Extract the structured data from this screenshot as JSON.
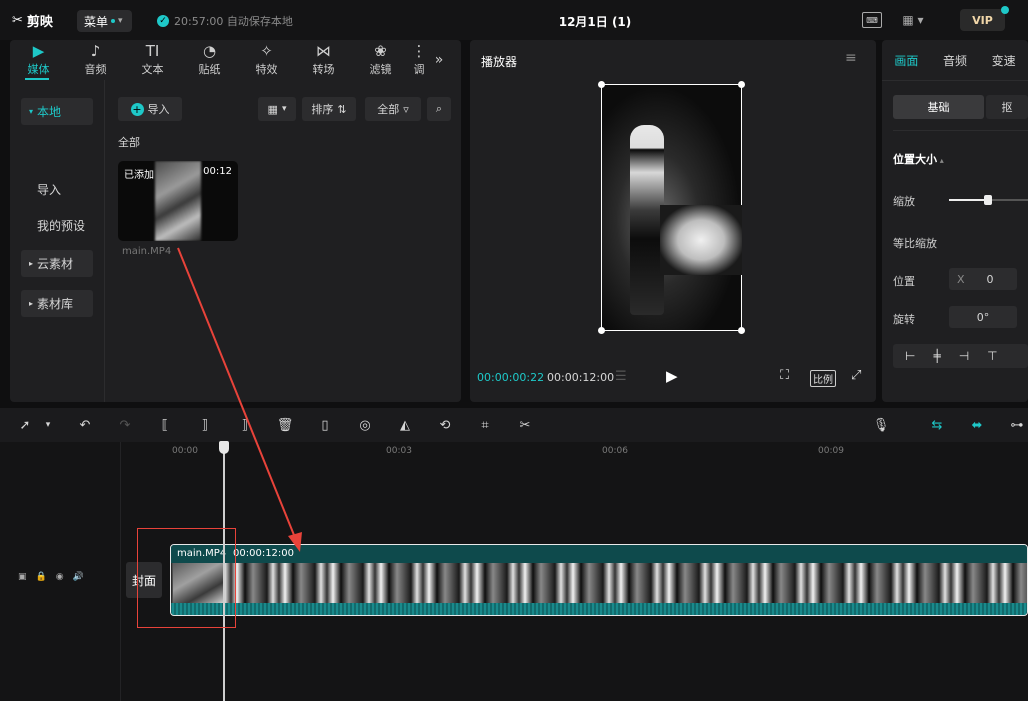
{
  "app": {
    "logo": "剪映",
    "menu_label": "菜单",
    "save_status": "20:57:00 自动保存本地",
    "project_title": "12月1日 (1)",
    "vip_label": "VIP"
  },
  "media_tabs": [
    {
      "label": "媒体",
      "icon": "media-icon",
      "active": true
    },
    {
      "label": "音频",
      "icon": "audio-icon"
    },
    {
      "label": "文本",
      "icon": "text-icon"
    },
    {
      "label": "贴纸",
      "icon": "sticker-icon"
    },
    {
      "label": "特效",
      "icon": "effects-icon"
    },
    {
      "label": "转场",
      "icon": "transition-icon"
    },
    {
      "label": "滤镜",
      "icon": "filter-icon"
    },
    {
      "label": "调",
      "icon": "adjust-icon"
    }
  ],
  "sidebar": {
    "items": [
      "本地",
      "导入",
      "我的预设",
      "云素材",
      "素材库"
    ]
  },
  "media": {
    "import_label": "导入",
    "sort_label": "排序",
    "all_filter_label": "全部",
    "section_label": "全部",
    "clip": {
      "badge": "已添加",
      "duration": "00:12",
      "name": "main.MP4"
    }
  },
  "player": {
    "title": "播放器",
    "current_time": "00:00:00:22",
    "total_time": "00:00:12:00",
    "ratio_label": "比例"
  },
  "inspector": {
    "tabs": [
      "画面",
      "音频",
      "变速"
    ],
    "subtab": "基础",
    "subtab2": "抠",
    "section": "位置大小",
    "scale_label": "缩放",
    "scale_value": 0.3,
    "uniform_label": "等比缩放",
    "position_label": "位置",
    "x_label": "X",
    "x_value": "0",
    "rotate_label": "旋转",
    "rotate_value": "0°"
  },
  "timeline": {
    "ruler": [
      "00:00",
      "00:03",
      "00:06",
      "00:09"
    ],
    "cover_label": "封面",
    "clip_name": "main.MP4",
    "clip_duration": "00:00:12:00"
  },
  "colors": {
    "accent": "#1ec8c8",
    "annotation": "#e8433a"
  }
}
